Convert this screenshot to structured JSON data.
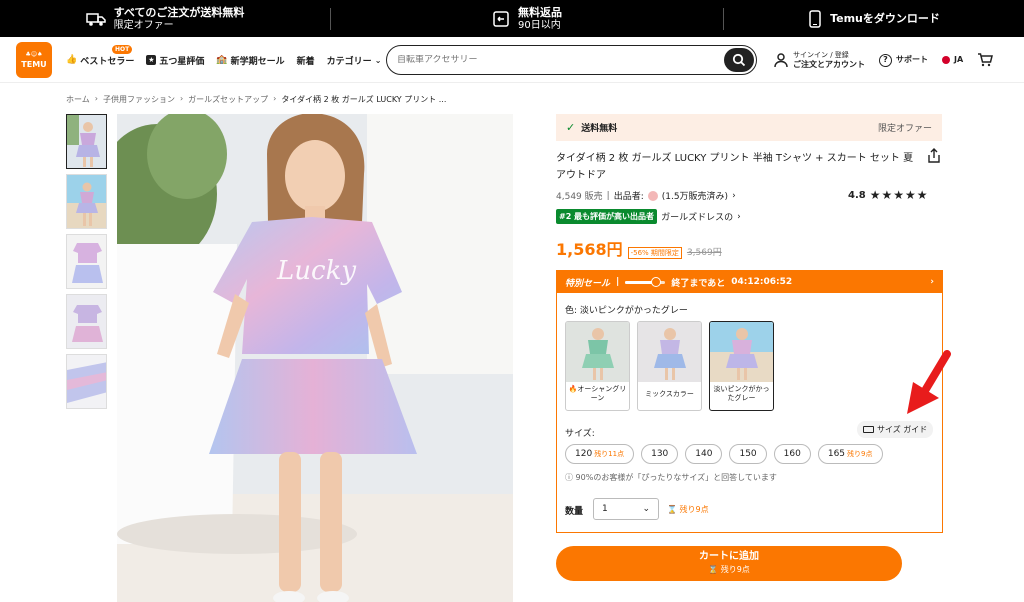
{
  "topbar": {
    "shipping_title": "すべてのご注文が送料無料",
    "shipping_sub": "限定オファー",
    "returns_title": "無料返品",
    "returns_sub": "90日以内",
    "download": "Temuをダウンロード"
  },
  "header": {
    "logo_text": "TEMU",
    "nav": [
      {
        "label": "ベストセラー",
        "badge": "HOT"
      },
      {
        "label": "五つ星評価"
      },
      {
        "label": "新学期セール"
      },
      {
        "label": "新着"
      },
      {
        "label": "カテゴリー"
      }
    ],
    "search_placeholder": "自転車アクセサリー",
    "signin_line1": "サインイン / 登録",
    "signin_line2": "ご注文とアカウント",
    "support": "サポート",
    "language": "JA"
  },
  "breadcrumb": [
    "ホーム",
    "子供用ファッション",
    "ガールズセットアップ",
    "タイダイ柄 2 枚 ガールズ LUCKY プリント ..."
  ],
  "product": {
    "shipping_label": "送料無料",
    "limited_offer": "限定オファー",
    "title": "タイダイ柄 2 枚 ガールズ LUCKY プリント 半袖 Tシャツ + スカート セット 夏 アウトドア",
    "sold": "4,549 販売",
    "seller_label": "出品者:",
    "seller_sales": "(1.5万販売済み)",
    "rating": "4.8",
    "stars": "★★★★★",
    "rank_badge": "#2 最も評価が高い出品者",
    "rank_category": "ガールズドレスの",
    "price": "1,568円",
    "discount": "-56% 期間限定",
    "original_price": "3,569円"
  },
  "sale": {
    "label": "特別セール",
    "countdown_label": "終了まであと",
    "countdown": "04:12:06:52"
  },
  "color": {
    "label": "色: 淡いピンクがかったグレー",
    "options": [
      {
        "label": "オーシャングリーン"
      },
      {
        "label": "ミックスカラー"
      },
      {
        "label": "淡いピンクがかったグレー"
      }
    ]
  },
  "size": {
    "label": "サイズ:",
    "guide": "サイズ ガイド",
    "options": [
      {
        "size": "120",
        "left": "残り11点"
      },
      {
        "size": "130",
        "left": ""
      },
      {
        "size": "140",
        "left": ""
      },
      {
        "size": "150",
        "left": ""
      },
      {
        "size": "160",
        "left": ""
      },
      {
        "size": "165",
        "left": "残り9点"
      }
    ],
    "fit_note": "90%のお客様が「ぴったりなサイズ」と回答しています"
  },
  "quantity": {
    "label": "数量",
    "value": "1",
    "stock": "残り9点"
  },
  "cart": {
    "label": "カートに追加",
    "sub": "残り9点"
  },
  "colors": {
    "accent": "#fb7701",
    "top_bar": "#000000",
    "shipping_bg": "#fdeee4",
    "rank_green": "#0a8a2e",
    "annotation_arrow": "#e81c1c"
  }
}
